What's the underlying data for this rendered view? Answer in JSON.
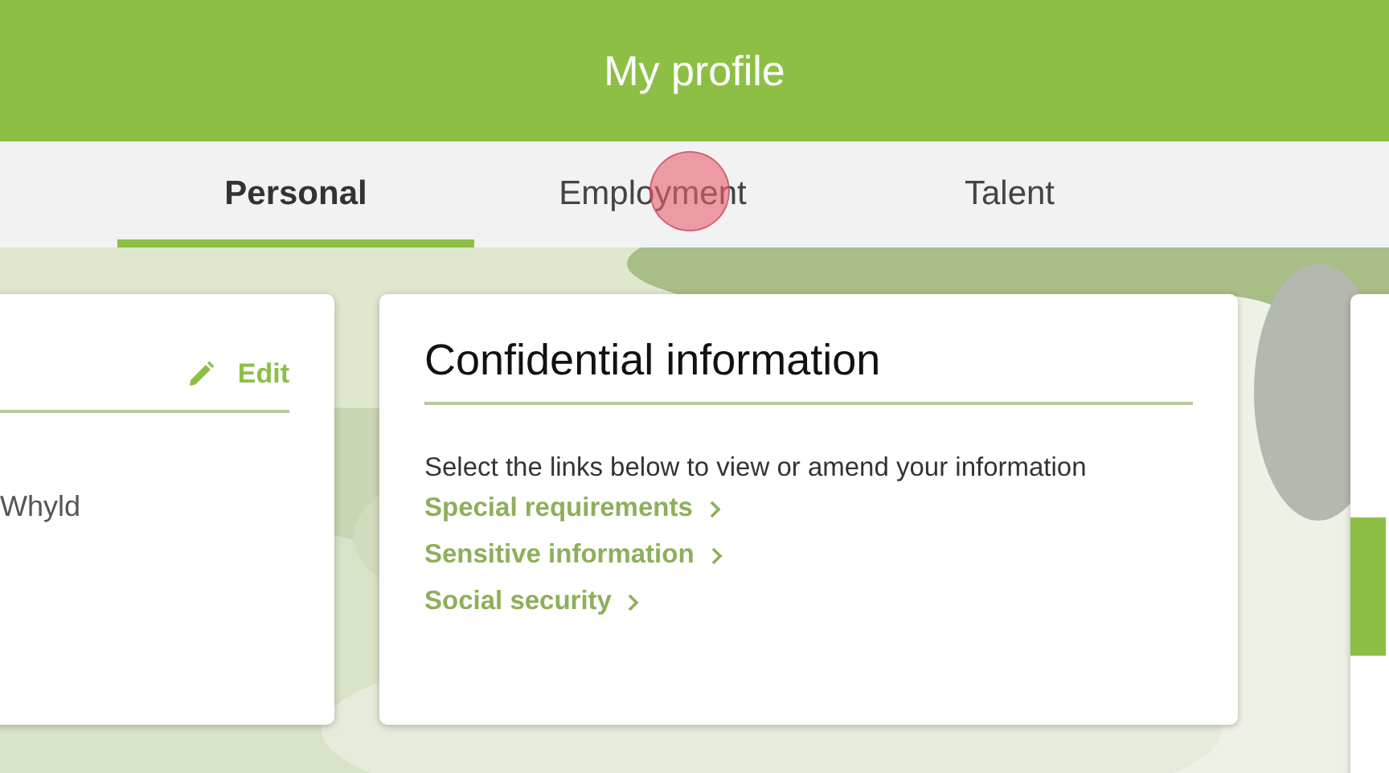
{
  "header": {
    "title": "My profile"
  },
  "tabs": [
    {
      "label": "Personal",
      "selected": true
    },
    {
      "label": "Employment",
      "selected": false
    },
    {
      "label": "Talent",
      "selected": false
    }
  ],
  "name_card": {
    "edit_label": "Edit",
    "name": "Whyld"
  },
  "confidential_card": {
    "title": "Confidential information",
    "intro": "Select the links below to view or amend your information",
    "links": [
      {
        "label": "Special requirements"
      },
      {
        "label": "Sensitive information"
      },
      {
        "label": "Social security"
      }
    ]
  }
}
